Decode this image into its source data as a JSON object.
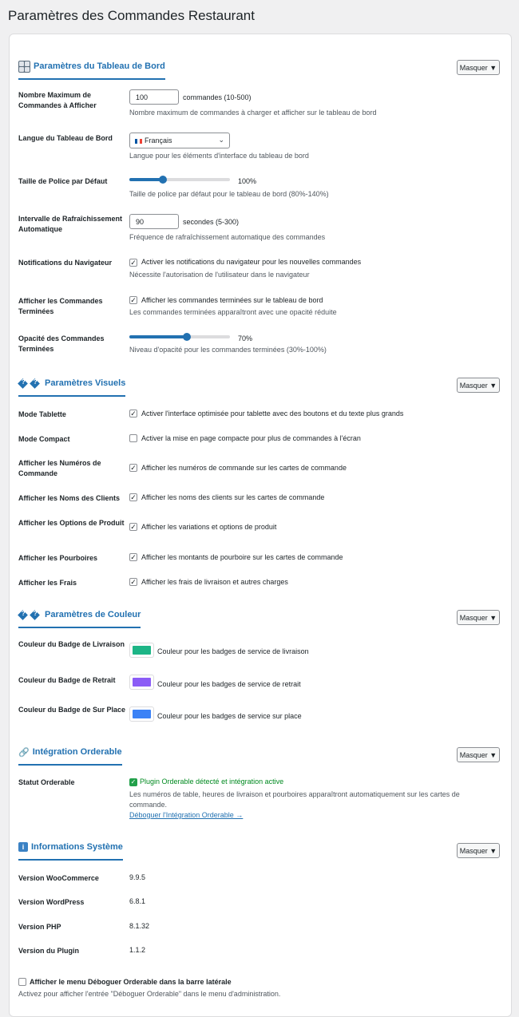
{
  "page": {
    "title": "Paramètres des Commandes Restaurant"
  },
  "hide_label": "Masquer ▼",
  "sections": {
    "dashboard": {
      "title": "Paramètres du Tableau de Bord",
      "icon": "dashboard-grid-icon"
    },
    "visual": {
      "title": "Paramètres Visuels",
      "icon": "unknown-glyph-icon"
    },
    "color": {
      "title": "Paramètres de Couleur",
      "icon": "unknown-glyph-icon"
    },
    "orderable": {
      "title": "Intégration Orderable",
      "icon": "link-icon"
    },
    "system": {
      "title": "Informations Système",
      "icon": "info-icon"
    }
  },
  "dashboard": {
    "max_orders": {
      "label": "Nombre Maximum de Commandes à Afficher",
      "value": "100",
      "suffix": "commandes (10-500)",
      "desc": "Nombre maximum de commandes à charger et afficher sur le tableau de bord"
    },
    "language": {
      "label": "Langue du Tableau de Bord",
      "value": "Français",
      "desc": "Langue pour les éléments d'interface du tableau de bord"
    },
    "font_size": {
      "label": "Taille de Police par Défaut",
      "value": "100%",
      "level": 0.33,
      "desc": "Taille de police par défaut pour le tableau de bord (80%-140%)"
    },
    "refresh": {
      "label": "Intervalle de Rafraîchissement Automatique",
      "value": "90",
      "suffix": "secondes (5-300)",
      "desc": "Fréquence de rafraîchissement automatique des commandes"
    },
    "notifications": {
      "label": "Notifications du Navigateur",
      "checked": true,
      "text": "Activer les notifications du navigateur pour les nouvelles commandes",
      "desc": "Nécessite l'autorisation de l'utilisateur dans le navigateur"
    },
    "show_completed": {
      "label": "Afficher les Commandes Terminées",
      "checked": true,
      "text": "Afficher les commandes terminées sur le tableau de bord",
      "desc": "Les commandes terminées apparaîtront avec une opacité réduite"
    },
    "opacity": {
      "label": "Opacité des Commandes Terminées",
      "value": "70%",
      "level": 0.57,
      "desc": "Niveau d'opacité pour les commandes terminées (30%-100%)"
    }
  },
  "visual": {
    "tablet": {
      "label": "Mode Tablette",
      "checked": true,
      "text": "Activer l'interface optimisée pour tablette avec des boutons et du texte plus grands"
    },
    "compact": {
      "label": "Mode Compact",
      "checked": false,
      "text": "Activer la mise en page compacte pour plus de commandes à l'écran"
    },
    "order_numbers": {
      "label": "Afficher les Numéros de Commande",
      "checked": true,
      "text": "Afficher les numéros de commande sur les cartes de commande"
    },
    "customer_names": {
      "label": "Afficher les Noms des Clients",
      "checked": true,
      "text": "Afficher les noms des clients sur les cartes de commande"
    },
    "product_options": {
      "label": "Afficher les Options de Produit",
      "checked": true,
      "text": "Afficher les variations et options de produit"
    },
    "tips": {
      "label": "Afficher les Pourboires",
      "checked": true,
      "text": "Afficher les montants de pourboire sur les cartes de commande"
    },
    "fees": {
      "label": "Afficher les Frais",
      "checked": true,
      "text": "Afficher les frais de livraison et autres charges"
    }
  },
  "color": {
    "delivery": {
      "label": "Couleur du Badge de Livraison",
      "color": "#1db586",
      "text": "Couleur pour les badges de service de livraison"
    },
    "pickup": {
      "label": "Couleur du Badge de Retrait",
      "color": "#8b5cf6",
      "text": "Couleur pour les badges de service de retrait"
    },
    "dinein": {
      "label": "Couleur du Badge de Sur Place",
      "color": "#3b82f6",
      "text": "Couleur pour les badges de service sur place"
    }
  },
  "orderable": {
    "status_label": "Statut Orderable",
    "status_text": "Plugin Orderable détecté et intégration active",
    "desc_line1": "Les numéros de table, heures de livraison et pourboires apparaîtront automatiquement sur les cartes de",
    "desc_line2": "commande.",
    "debug_link": "Déboguer l'Intégration Orderable →"
  },
  "system": {
    "rows": [
      {
        "label": "Version WooCommerce",
        "value": "9.9.5"
      },
      {
        "label": "Version WordPress",
        "value": "6.8.1"
      },
      {
        "label": "Version PHP",
        "value": "8.1.32"
      },
      {
        "label": "Version du Plugin",
        "value": "1.1.2"
      }
    ]
  },
  "footer": {
    "checked": false,
    "text": "Afficher le menu Déboguer Orderable dans la barre latérale",
    "desc": "Activez pour afficher l'entrée \"Déboguer Orderable\" dans le menu d'administration."
  }
}
